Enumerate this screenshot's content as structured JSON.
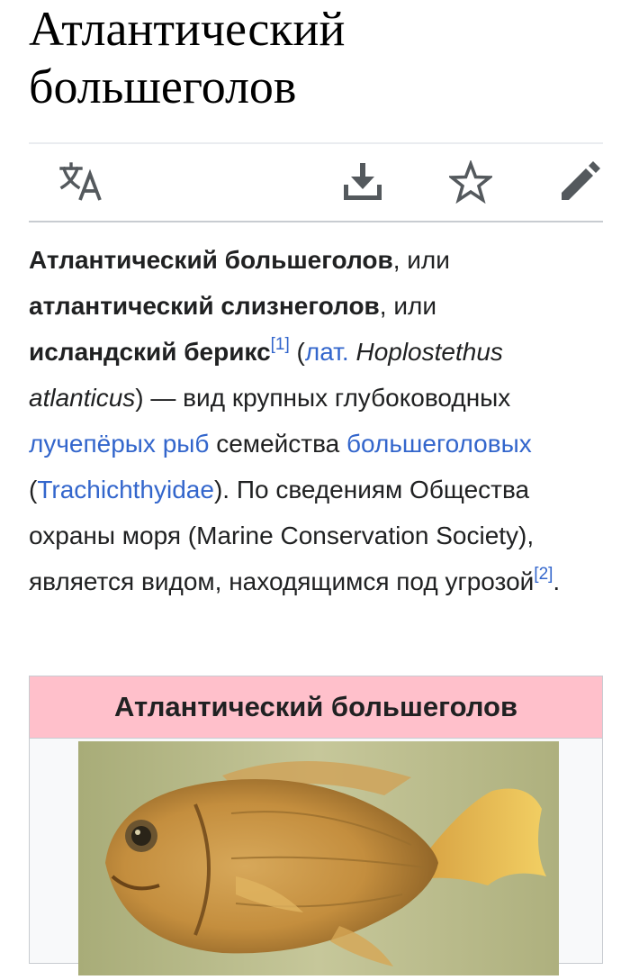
{
  "page": {
    "title": "Атлантический большеголов"
  },
  "toolbar": {
    "language_icon": "translate-icon",
    "download_icon": "download-icon",
    "watch_icon": "star-icon",
    "edit_icon": "pencil-icon"
  },
  "lead": {
    "name1": "Атлантический большеголов",
    "sep1": ", или",
    "name2": "атлантический слизнеголов",
    "sep2": ", или",
    "name3": "исландский берикс",
    "ref1": "[1]",
    "open_paren": " (",
    "lat_link": "лат.",
    "sci_name": " Hoplostethus atlanticus",
    "text1": ") — вид крупных глубоководных ",
    "link_rayfin": "лучепёрых рыб",
    "text2": " семейства ",
    "link_family": "большеголовых",
    "text3": " (",
    "link_trach": "Trachichthyidae",
    "text4": "). По сведениям Общества охраны моря (Marine Conservation Society), является видом, находящимся под угрозой",
    "ref2": "[2]",
    "end": "."
  },
  "infobox": {
    "title": "Атлантический большеголов",
    "header_color": "#ffc0cb"
  },
  "colors": {
    "link": "#3366cc",
    "text": "#202122",
    "icon": "#54595d"
  }
}
